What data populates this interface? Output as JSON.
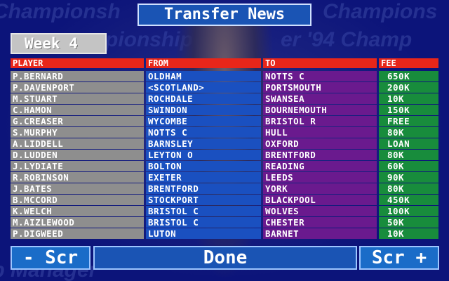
{
  "title": "Transfer News",
  "week_label": "Week 4",
  "columns": {
    "player": "PLAYER",
    "from": "FROM",
    "to": "TO",
    "fee": "FEE"
  },
  "rows": [
    {
      "player": "P.BERNARD",
      "from": "OLDHAM",
      "to": "NOTTS C",
      "fee": "650K"
    },
    {
      "player": "P.DAVENPORT",
      "from": "<SCOTLAND>",
      "to": "PORTSMOUTH",
      "fee": "200K"
    },
    {
      "player": "M.STUART",
      "from": "ROCHDALE",
      "to": "SWANSEA",
      "fee": "10K"
    },
    {
      "player": "C.HAMON",
      "from": "SWINDON",
      "to": "BOURNEMOUTH",
      "fee": "150K"
    },
    {
      "player": "G.CREASER",
      "from": "WYCOMBE",
      "to": "BRISTOL R",
      "fee": "FREE"
    },
    {
      "player": "S.MURPHY",
      "from": "NOTTS C",
      "to": "HULL",
      "fee": "80K"
    },
    {
      "player": "A.LIDDELL",
      "from": "BARNSLEY",
      "to": "OXFORD",
      "fee": "LOAN"
    },
    {
      "player": "D.LUDDEN",
      "from": "LEYTON O",
      "to": "BRENTFORD",
      "fee": "80K"
    },
    {
      "player": "J.LYDIATE",
      "from": "BOLTON",
      "to": "READING",
      "fee": "60K"
    },
    {
      "player": "R.ROBINSON",
      "from": "EXETER",
      "to": "LEEDS",
      "fee": "90K"
    },
    {
      "player": "J.BATES",
      "from": "BRENTFORD",
      "to": "YORK",
      "fee": "80K"
    },
    {
      "player": "B.MCCORD",
      "from": "STOCKPORT",
      "to": "BLACKPOOL",
      "fee": "450K"
    },
    {
      "player": "K.WELCH",
      "from": "BRISTOL C",
      "to": "WOLVES",
      "fee": "100K"
    },
    {
      "player": "M.AIZLEWOOD",
      "from": "BRISTOL C",
      "to": "CHESTER",
      "fee": "50K"
    },
    {
      "player": "P.DIGWEED",
      "from": "LUTON",
      "to": "BARNET",
      "fee": "10K"
    }
  ],
  "buttons": {
    "scroll_down": "- Scr",
    "done": "Done",
    "scroll_up": "Scr +"
  },
  "background_text": [
    "Championsh",
    "Champions",
    "pionship",
    "er '94 Champ",
    "ip Manager"
  ],
  "colors": {
    "header": "#e8261a",
    "player": "#8e8e8e",
    "from": "#1a50c0",
    "to": "#6a1a8e",
    "fee": "#188c3c",
    "button": "#1a6cc8"
  }
}
